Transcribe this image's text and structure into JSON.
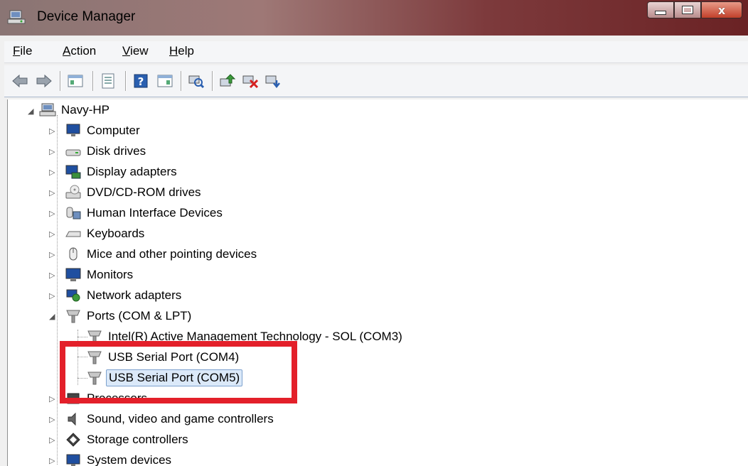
{
  "window": {
    "title": "Device Manager",
    "accent": "#7d3a3c",
    "buttons": {
      "minimize_icon": "minimize-icon",
      "maximize_icon": "maximize-icon",
      "close_glyph": "x"
    }
  },
  "menu": {
    "file": "File",
    "action": "Action",
    "view": "View",
    "help": "Help"
  },
  "toolbar": {
    "icons": [
      "back-arrow-icon",
      "forward-arrow-icon",
      "show-hide-console-tree-icon",
      "properties-icon",
      "help-icon",
      "action-pane-icon",
      "scan-hardware-icon",
      "update-driver-icon",
      "uninstall-device-icon",
      "enable-device-icon"
    ]
  },
  "tree": {
    "root": {
      "label": "Navy-HP"
    },
    "categories": [
      {
        "label": "Computer",
        "icon": "computer-icon"
      },
      {
        "label": "Disk drives",
        "icon": "disk-drive-icon"
      },
      {
        "label": "Display adapters",
        "icon": "display-adapter-icon"
      },
      {
        "label": "DVD/CD-ROM drives",
        "icon": "dvd-drive-icon"
      },
      {
        "label": "Human Interface Devices",
        "icon": "hid-icon"
      },
      {
        "label": "Keyboards",
        "icon": "keyboard-icon"
      },
      {
        "label": "Mice and other pointing devices",
        "icon": "mouse-icon"
      },
      {
        "label": "Monitors",
        "icon": "monitor-icon"
      },
      {
        "label": "Network adapters",
        "icon": "network-adapter-icon"
      },
      {
        "label": "Ports (COM & LPT)",
        "icon": "port-icon"
      },
      {
        "label": "Processors",
        "icon": "processor-icon"
      },
      {
        "label": "Sound, video and game controllers",
        "icon": "sound-icon"
      },
      {
        "label": "Storage controllers",
        "icon": "storage-controller-icon"
      },
      {
        "label": "System devices",
        "icon": "system-device-icon"
      }
    ],
    "ports_children": [
      {
        "label": "Intel(R) Active Management Technology - SOL (COM3)"
      },
      {
        "label": "USB Serial Port (COM4)"
      },
      {
        "label": "USB Serial Port (COM5)",
        "selected": true
      }
    ],
    "collapsed_glyph": "▷",
    "expanded_glyph": "◢"
  },
  "annotation": {
    "color": "#e3202a"
  }
}
